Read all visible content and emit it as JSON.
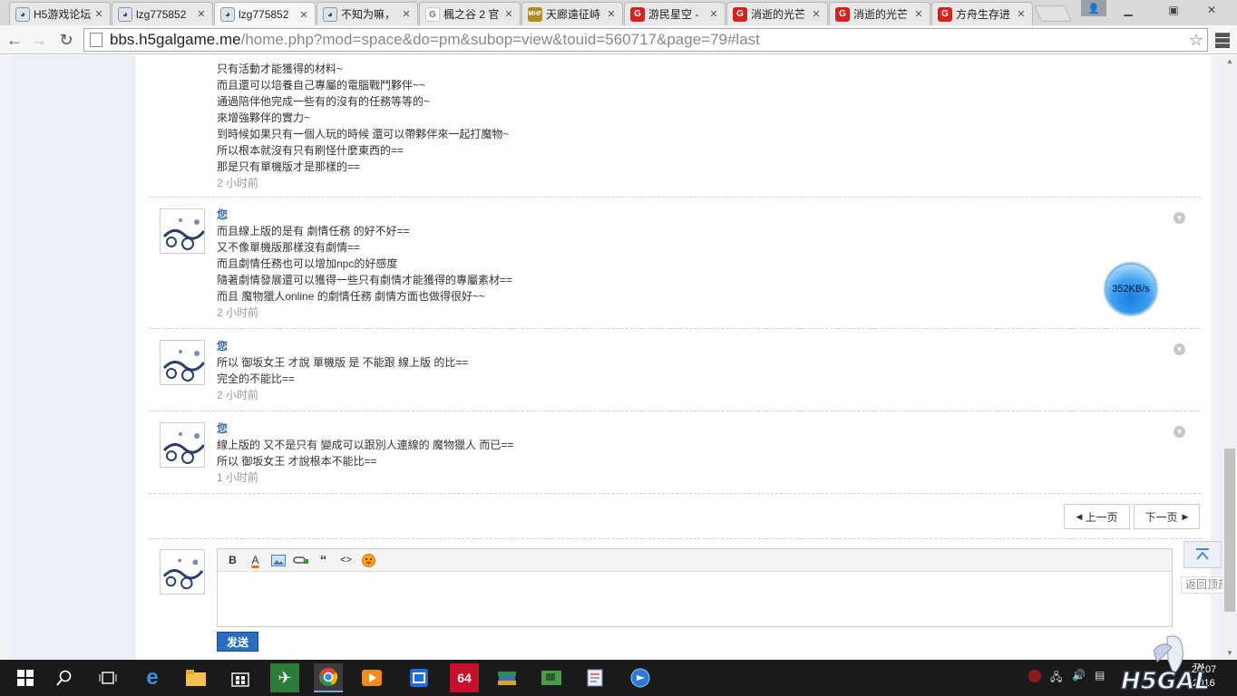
{
  "tabs": [
    {
      "title": "H5游戏论坛",
      "icon": "avatar"
    },
    {
      "title": "lzg775852",
      "icon": "avatar"
    },
    {
      "title": "lzg775852",
      "icon": "avatar",
      "active": true
    },
    {
      "title": "不知为嘛，",
      "icon": "avatar"
    },
    {
      "title": "楓之谷 2 官",
      "icon": "g"
    },
    {
      "title": "天廊遠征峙",
      "icon": "mhf"
    },
    {
      "title": "游民星空 -",
      "icon": "red"
    },
    {
      "title": "消逝的光芒",
      "icon": "red"
    },
    {
      "title": "消逝的光芒",
      "icon": "red"
    },
    {
      "title": "方舟生存进",
      "icon": "red"
    }
  ],
  "address": {
    "host": "bbs.h5galgame.me",
    "path": "/home.php?mod=space&do=pm&subop=view&touid=560717&page=79#last"
  },
  "messages": [
    {
      "author": "",
      "lines": [
        "只有活動才能獲得的材料~",
        "而且還可以培養自己專屬的電腦戰鬥夥伴~~",
        "通過陪伴他完成一些有的沒有的任務等等的~",
        "來增強夥伴的實力~",
        "到時候如果只有一個人玩的時候 還可以帶夥伴來一起打魔物~",
        "所以根本就沒有只有刷怪什麼東西的==",
        "那是只有單機版才是那樣的=="
      ],
      "time": "2 小时前"
    },
    {
      "author": "您",
      "lines": [
        "而且線上版的是有 劇情任務 的好不好==",
        "又不像單機版那樣沒有劇情==",
        "而且劇情任務也可以增加npc的好感度",
        "隨著劇情發展還可以獲得一些只有劇情才能獲得的專屬素材==",
        "而且 魔物獵人online 的劇情任務 劇情方面也做得很好~~"
      ],
      "time": "2 小时前"
    },
    {
      "author": "您",
      "lines": [
        "所以 御坂女王 才說 單機版 是 不能跟 線上版 的比==",
        "完全的不能比=="
      ],
      "time": "2 小时前"
    },
    {
      "author": "您",
      "lines": [
        "線上版的 又不是只有 變成可以跟別人連線的 魔物獵人 而已==",
        "所以 御坂女王 才說根本不能比=="
      ],
      "time": "1 小时前"
    }
  ],
  "pager": {
    "prev": "上一页",
    "next": "下一页"
  },
  "editor": {
    "send": "发送",
    "toolbar": [
      "B",
      "A",
      "image",
      "link",
      "“",
      "<>",
      "emoji"
    ]
  },
  "net_widget": {
    "speed": "352KB/s"
  },
  "back_to_top": "返回顶部",
  "taskbar": {
    "clock_time": "20:07",
    "clock_date": "2016"
  }
}
